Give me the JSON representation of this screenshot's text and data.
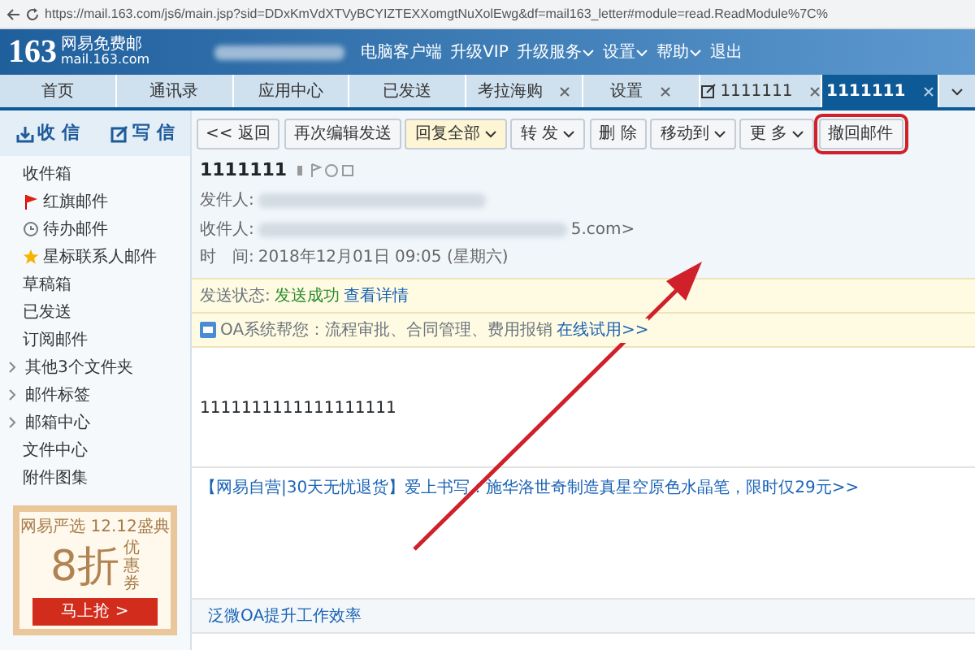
{
  "browser": {
    "url": "https://mail.163.com/js6/main.jsp?sid=DDxKmVdXTVyBCYIZTEXXomgtNuXolEwg&df=mail163_letter#module=read.ReadModule%7C%"
  },
  "header": {
    "logo": "163",
    "logo_subtitle": "网易免费邮",
    "logo_domain": "mail.163.com",
    "links": [
      {
        "label": "电脑客户端",
        "dropdown": false
      },
      {
        "label": "升级VIP",
        "dropdown": false
      },
      {
        "label": "升级服务",
        "dropdown": true
      },
      {
        "label": "设置",
        "dropdown": true
      },
      {
        "label": "帮助",
        "dropdown": true
      },
      {
        "label": "退出",
        "dropdown": false
      }
    ]
  },
  "tabs": [
    {
      "label": "首页",
      "closable": false,
      "selected": false,
      "kind": "plain"
    },
    {
      "label": "通讯录",
      "closable": false,
      "selected": false,
      "kind": "plain"
    },
    {
      "label": "应用中心",
      "closable": false,
      "selected": false,
      "kind": "plain"
    },
    {
      "label": "已发送",
      "closable": false,
      "selected": false,
      "kind": "plain"
    },
    {
      "label": "考拉海购",
      "closable": true,
      "selected": false,
      "kind": "plain"
    },
    {
      "label": "设置",
      "closable": true,
      "selected": false,
      "kind": "plain"
    },
    {
      "label": "1111111",
      "closable": true,
      "selected": false,
      "kind": "compose"
    },
    {
      "label": "1111111",
      "closable": true,
      "selected": true,
      "kind": "plain"
    }
  ],
  "sidebar": {
    "receive": "收 信",
    "write": "写 信",
    "folders": [
      {
        "label": "收件箱",
        "kind": "plain",
        "expandable": false
      },
      {
        "label": "红旗邮件",
        "kind": "flag",
        "expandable": false
      },
      {
        "label": "待办邮件",
        "kind": "clock",
        "expandable": false
      },
      {
        "label": "星标联系人邮件",
        "kind": "star",
        "expandable": false
      },
      {
        "label": "草稿箱",
        "kind": "plain",
        "expandable": false
      },
      {
        "label": "已发送",
        "kind": "plain",
        "expandable": false
      },
      {
        "label": "订阅邮件",
        "kind": "plain",
        "expandable": false
      },
      {
        "label": "其他3个文件夹",
        "kind": "plain",
        "expandable": true
      },
      {
        "label": "邮件标签",
        "kind": "plain",
        "expandable": true
      },
      {
        "label": "邮箱中心",
        "kind": "plain",
        "expandable": true
      },
      {
        "label": "文件中心",
        "kind": "plain",
        "expandable": false
      },
      {
        "label": "附件图集",
        "kind": "plain",
        "expandable": false
      }
    ],
    "promo": {
      "title": "网易严选 12.12盛典",
      "discount": "8折",
      "coupon": "优惠券",
      "button": "马上抢 >"
    }
  },
  "toolbar": [
    {
      "label": "<< 返回",
      "dropdown": false,
      "highlighted": false,
      "annotated": false
    },
    {
      "label": "再次编辑发送",
      "dropdown": false,
      "highlighted": false,
      "annotated": false
    },
    {
      "label": "回复全部",
      "dropdown": true,
      "highlighted": true,
      "annotated": false
    },
    {
      "label": "转 发",
      "dropdown": true,
      "highlighted": false,
      "annotated": false
    },
    {
      "label": "删 除",
      "dropdown": false,
      "highlighted": false,
      "annotated": false
    },
    {
      "label": "移动到",
      "dropdown": true,
      "highlighted": false,
      "annotated": false
    },
    {
      "label": "更 多",
      "dropdown": true,
      "highlighted": false,
      "annotated": false
    },
    {
      "label": "撤回邮件",
      "dropdown": false,
      "highlighted": false,
      "annotated": true
    }
  ],
  "message": {
    "subject": "1111111",
    "sender_label": "发件人:",
    "recipient_label": "收件人:",
    "recipient_tail": "5.com>",
    "time_label": "时　间:",
    "time": "2018年12月01日 09:05 (星期六)",
    "status": {
      "label": "发送状态:",
      "value": "发送成功",
      "link": "查看详情"
    },
    "oa": {
      "text": "OA系统帮您：流程审批、合同管理、费用报销",
      "link": "在线试用>>"
    },
    "body": "1111111111111111111",
    "ad": "【网易自营|30天无忧退货】爱上书写：施华洛世奇制造真星空原色水晶笔，限时仅29元>>",
    "footer_link": "泛微OA提升工作效率"
  }
}
